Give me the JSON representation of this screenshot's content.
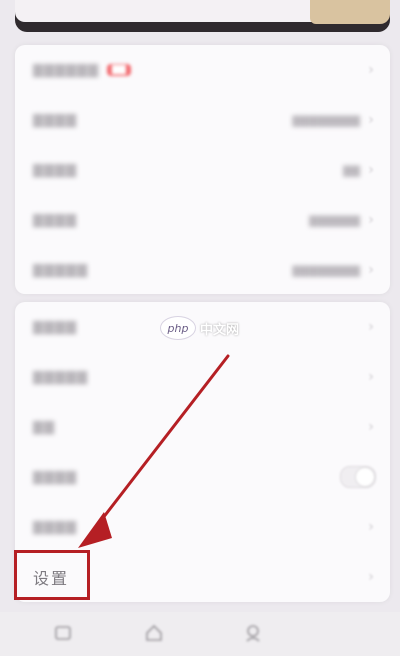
{
  "card2_rows": {
    "settings_label": "设置"
  },
  "watermark": {
    "logo_text": "php",
    "text": "中文网"
  },
  "colors": {
    "annotation_red": "#b51f24",
    "badge_red": "#f26a6f"
  },
  "icons": {
    "row_chevron": "chevron-right-icon",
    "tab1": "home-icon",
    "tab2": "home-icon",
    "tab3": "profile-icon"
  }
}
